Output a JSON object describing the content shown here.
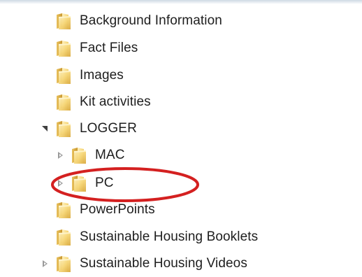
{
  "tree": {
    "items": [
      {
        "label": "Background Information",
        "toggle": "none",
        "icon": "folder-icon"
      },
      {
        "label": "Fact Files",
        "toggle": "none",
        "icon": "folder-icon"
      },
      {
        "label": "Images",
        "toggle": "none",
        "icon": "folder-icon"
      },
      {
        "label": "Kit activities",
        "toggle": "none",
        "icon": "folder-icon"
      },
      {
        "label": "LOGGER",
        "toggle": "expanded",
        "icon": "folder-icon"
      },
      {
        "label": "MAC",
        "toggle": "collapsed",
        "icon": "folder-icon"
      },
      {
        "label": "PC",
        "toggle": "collapsed",
        "icon": "folder-icon"
      },
      {
        "label": "PowerPoints",
        "toggle": "none",
        "icon": "folder-icon"
      },
      {
        "label": "Sustainable Housing Booklets",
        "toggle": "none",
        "icon": "folder-icon"
      },
      {
        "label": "Sustainable Housing Videos",
        "toggle": "collapsed",
        "icon": "folder-icon"
      }
    ]
  },
  "annotation": {
    "shape": "ellipse",
    "color": "#d42020",
    "target": "PC"
  },
  "colors": {
    "folder_light": "#fbe9a8",
    "folder_dark": "#e3b94f",
    "text": "#1e1e1e"
  }
}
